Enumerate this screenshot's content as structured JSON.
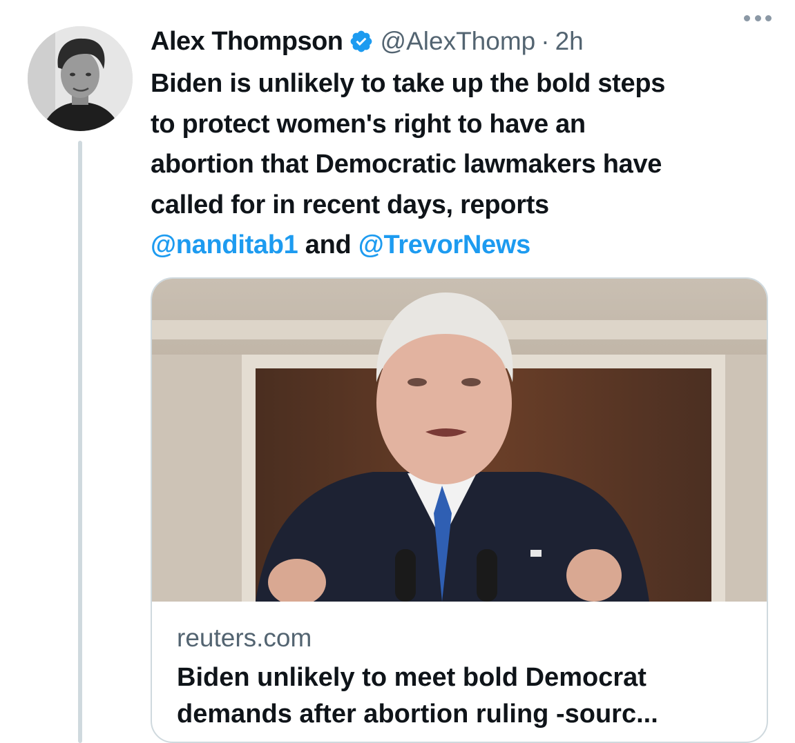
{
  "tweet": {
    "author": {
      "display_name": "Alex Thompson",
      "verified": true,
      "handle": "@AlexThomp",
      "separator": "·",
      "timestamp": "2h"
    },
    "text_lines": [
      "Biden is unlikely to take up the bold steps",
      "to protect women's right to have an",
      "abortion that Democratic lawmakers have",
      "called for in recent days, reports"
    ],
    "mention_1": "@nanditab1",
    "connector": "and",
    "mention_2": "@TrevorNews",
    "card": {
      "domain": "reuters.com",
      "title_line_1": "Biden unlikely to meet bold Democrat",
      "title_line_2": "demands after abortion ruling -sourc..."
    }
  },
  "colors": {
    "text": "#0f1419",
    "secondary": "#536471",
    "link": "#1d9bf0",
    "verified": "#1d9bf0",
    "border": "#cfd9de"
  },
  "icons": {
    "verified": "verified-badge-icon",
    "more": "more-horizontal-icon"
  }
}
